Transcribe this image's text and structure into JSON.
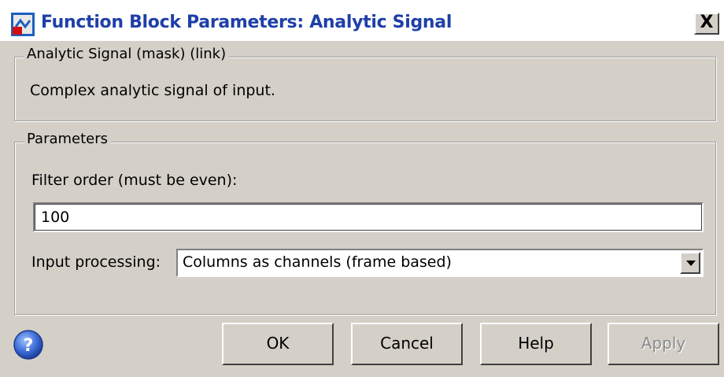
{
  "window": {
    "title": "Function Block Parameters: Analytic Signal",
    "close_label": "X",
    "icon": "simulink-block-icon"
  },
  "mask_group": {
    "legend": "Analytic Signal (mask) (link)",
    "description": "Complex analytic signal of input."
  },
  "params_group": {
    "legend": "Parameters",
    "filter_order_label": "Filter order (must be even):",
    "filter_order_value": "100",
    "input_processing_label": "Input processing:",
    "input_processing_value": "Columns as channels (frame based)"
  },
  "buttons": {
    "ok": "OK",
    "cancel": "Cancel",
    "help": "Help",
    "apply": "Apply"
  },
  "help_icon": "question-icon"
}
